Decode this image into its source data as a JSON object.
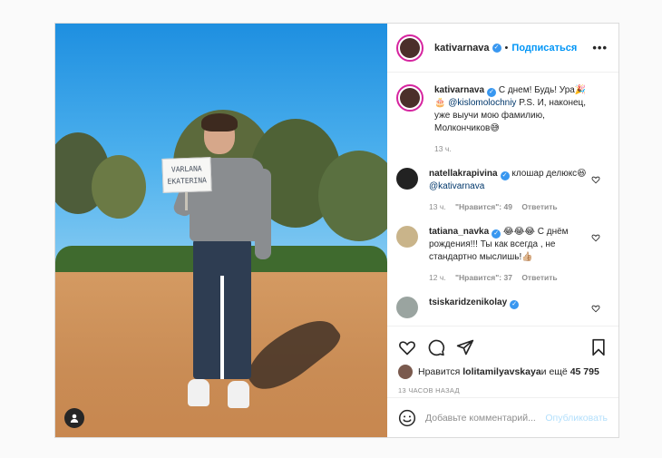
{
  "post": {
    "image": {
      "sign_text_line1": "VARLANA",
      "sign_text_line2": "EKATERINA"
    },
    "header": {
      "username": "kativarnava",
      "follow_label": "Подписаться",
      "more_label": "•••"
    },
    "caption": {
      "username": "kativarnava",
      "text_before": " С днем! Будь! Ура🎉🎂 ",
      "mention": "@kislomolochniy",
      "text_after": " P.S. И, наконец, уже выучи мою фамилию, Молкончиков😅",
      "time": "13 ч."
    },
    "comments": [
      {
        "username": "natellakrapivina",
        "text_before": " клошар делюкс😆 ",
        "mention": "@kativarnava",
        "time": "13 ч.",
        "likes": "\"Нравится\": 49",
        "reply": "Ответить"
      },
      {
        "username": "tatiana_navka",
        "text_before": " 😂😂😂 С днём рождения!!! Ты как всегда , не стандартно мыслишь!👍🏼",
        "mention": "",
        "time": "12 ч.",
        "likes": "\"Нравится\": 37",
        "reply": "Ответить"
      },
      {
        "username": "tsiskaridzenikolay",
        "text_before": "",
        "mention": "",
        "time": "",
        "likes": "",
        "reply": ""
      }
    ],
    "likes": {
      "prefix": "Нравится ",
      "user": "lolitamilyavskaya",
      "middle": " и ещё ",
      "count": "45 795"
    },
    "timestamp": "13 ЧАСОВ НАЗАД",
    "comment_box": {
      "placeholder": "Добавьте комментарий...",
      "publish_label": "Опубликовать"
    }
  },
  "colors": {
    "accent": "#0095f6",
    "border": "#dbdbdb",
    "muted": "#8e8e8e"
  },
  "icons": [
    "heart-icon",
    "comment-icon",
    "share-icon",
    "save-icon",
    "emoji-icon",
    "user-tag-icon",
    "verified-icon",
    "more-icon"
  ]
}
